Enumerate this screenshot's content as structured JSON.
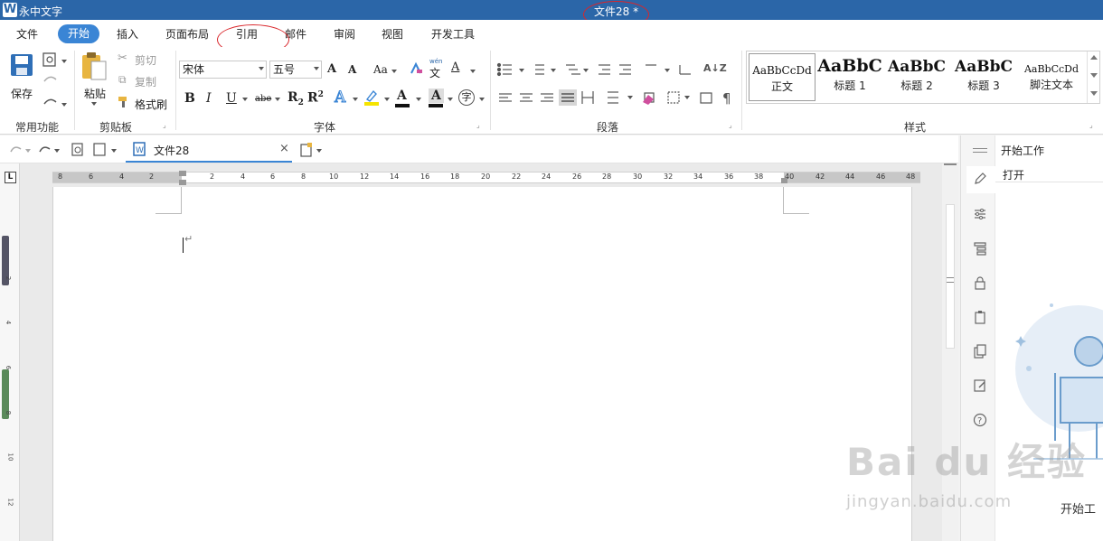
{
  "window": {
    "app_logo": "W",
    "app_name": "永中文字",
    "doc_title": "文件28 *"
  },
  "menu": {
    "active": "开始",
    "items": [
      "文件",
      "插入",
      "页面布局",
      "引用",
      "邮件",
      "审阅",
      "视图",
      "开发工具"
    ]
  },
  "ribbon": {
    "common": {
      "save": "保存",
      "group": "常用功能"
    },
    "clipboard": {
      "paste": "粘贴",
      "cut": "剪切",
      "copy": "复制",
      "format_painter": "格式刷",
      "group": "剪贴板"
    },
    "font": {
      "font_name": "宋体",
      "font_size": "五号",
      "group": "字体",
      "grow": "A",
      "shrink": "A",
      "case": "Aa",
      "phonetic_top": "wén",
      "phonetic_char": "文",
      "color_letter": "A",
      "bold": "B",
      "italic": "I",
      "underline": "U",
      "strike": "abe",
      "subscript": "R",
      "sub_mark": "2",
      "superscript": "R",
      "sup_mark": "2",
      "effect": "A",
      "highlight": "A",
      "char_shade": "A",
      "enclose_char": "字"
    },
    "paragraph": {
      "group": "段落",
      "show_marks": "¶",
      "sort": "A↓Z"
    },
    "styles": {
      "group": "样式",
      "items": [
        {
          "sample": "AaBbCcDd",
          "name": "正文"
        },
        {
          "sample": "AaBbC",
          "name": "标题 1"
        },
        {
          "sample": "AaBbC",
          "name": "标题 2"
        },
        {
          "sample": "AaBbC",
          "name": "标题 3"
        },
        {
          "sample": "AaBbCcDd",
          "name": "脚注文本"
        }
      ]
    }
  },
  "doc_tab": {
    "label": "文件28",
    "close": "×"
  },
  "ruler": {
    "left": [
      "8",
      "6",
      "4",
      "2"
    ],
    "right": [
      "2",
      "4",
      "6",
      "8",
      "10",
      "12",
      "14",
      "16",
      "18",
      "20",
      "22",
      "24",
      "26",
      "28",
      "30",
      "32",
      "34",
      "36",
      "38",
      "40",
      "42",
      "44",
      "46",
      "48"
    ],
    "vertical": [
      "2",
      "4",
      "6",
      "8",
      "10",
      "12"
    ]
  },
  "document": {
    "para_mark": "↵"
  },
  "taskpane": {
    "title": "开始工作",
    "open": "打开",
    "footer": "开始工"
  },
  "watermark": {
    "logo": "Bai du 经验",
    "url": "jingyan.baidu.com"
  },
  "colors": {
    "title_bar": "#2b66a8",
    "accent": "#3a85d5",
    "annotation": "#d9262b"
  }
}
